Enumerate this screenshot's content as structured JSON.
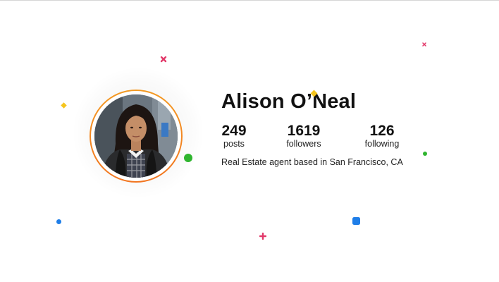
{
  "profile": {
    "name": "Alison O’Neal",
    "bio": "Real Estate agent based in San Francisco, CA",
    "stats": {
      "posts": {
        "value": "249",
        "label": "posts"
      },
      "followers": {
        "value": "1619",
        "label": "followers"
      },
      "following": {
        "value": "126",
        "label": "following"
      }
    }
  },
  "colors": {
    "ring_start": "#f39a23",
    "ring_end": "#f27520",
    "confetti_pink": "#e23a6a",
    "confetti_yellow": "#f5c51d",
    "confetti_green": "#2fb52f",
    "confetti_blue": "#1f7ee8"
  },
  "icons": {
    "avatar": "profile-photo",
    "confetti": [
      "cross",
      "diamond",
      "dot",
      "square",
      "plus"
    ]
  }
}
